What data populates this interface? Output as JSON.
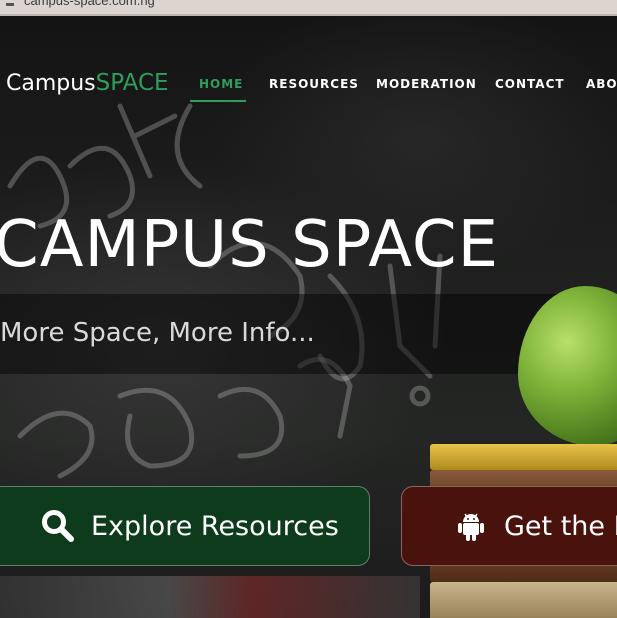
{
  "browser": {
    "url": "campus-space.com.ng"
  },
  "nav": {
    "brand_first": "Campus",
    "brand_second": "SPACE",
    "items": [
      {
        "label": "HOME",
        "active": true
      },
      {
        "label": "RESOURCES",
        "active": false
      },
      {
        "label": "MODERATION",
        "active": false
      },
      {
        "label": "CONTACT",
        "active": false
      },
      {
        "label": "ABOU",
        "active": false
      }
    ]
  },
  "hero": {
    "title": "CAMPUS SPACE",
    "subtitle": "More Space, More Info...",
    "background_chalk_text": "Back to School!"
  },
  "buttons": {
    "explore_label": "Explore Resources",
    "explore_icon": "search-icon",
    "get_label": "Get the M",
    "get_icon": "android-icon"
  },
  "colors": {
    "accent_green": "#2f9e5a",
    "explore_button_bg": "#0d3b1c",
    "get_button_bg": "#4a120d"
  }
}
